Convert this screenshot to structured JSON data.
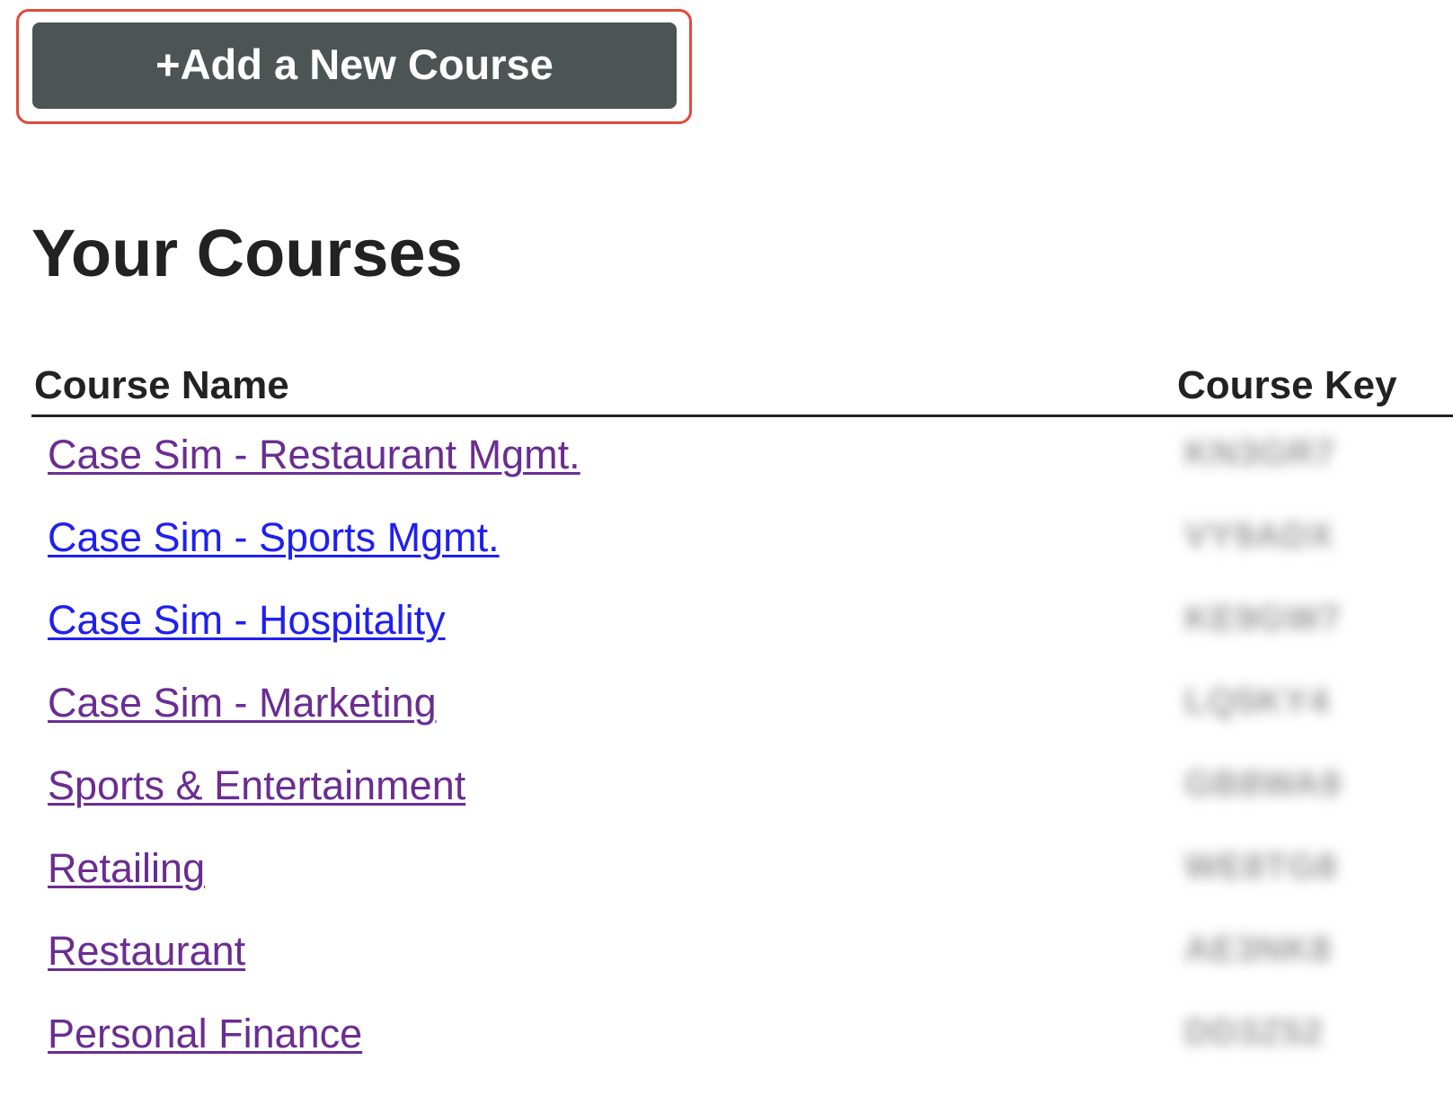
{
  "toolbar": {
    "add_course_label": "+Add a New Course"
  },
  "page": {
    "title": "Your Courses"
  },
  "table": {
    "headers": {
      "course_name": "Course Name",
      "course_key": "Course Key"
    },
    "rows": [
      {
        "name": "Case Sim - Restaurant Mgmt.",
        "key": "KN3GR7",
        "visited": true
      },
      {
        "name": "Case Sim - Sports Mgmt.",
        "key": "VY9ADX",
        "visited": false
      },
      {
        "name": "Case Sim - Hospitality",
        "key": "KE9GW7",
        "visited": false
      },
      {
        "name": "Case Sim - Marketing",
        "key": "LQ5KY4",
        "visited": true
      },
      {
        "name": "Sports & Entertainment",
        "key": "GB8WA9",
        "visited": true
      },
      {
        "name": "Retailing",
        "key": "WE8TG8",
        "visited": true
      },
      {
        "name": "Restaurant",
        "key": "AE3NK8",
        "visited": true
      },
      {
        "name": "Personal Finance",
        "key": "DD3Z52",
        "visited": true
      }
    ]
  },
  "colors": {
    "button_bg": "#4c5454",
    "highlight_border": "#e04b3c",
    "link_visited": "#6a2d91",
    "link_unvisited": "#1f1ff2"
  }
}
